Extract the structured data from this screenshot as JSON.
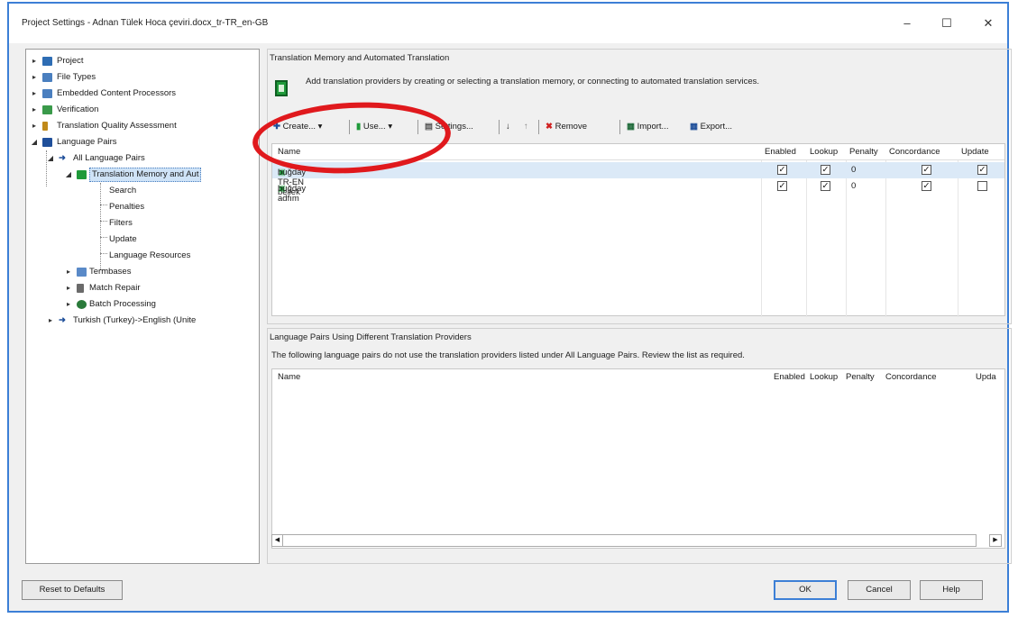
{
  "window": {
    "title": "Project Settings - Adnan Tülek Hoca çeviri.docx_tr-TR_en-GB",
    "controls": [
      "–",
      "☐",
      "✕"
    ]
  },
  "tree": {
    "items": [
      {
        "label": "Project",
        "toggle": "▸",
        "icon": "project-icon",
        "color": "#2e6db4"
      },
      {
        "label": "File Types",
        "toggle": "▸",
        "icon": "file-types-icon",
        "color": "#4a7fbf"
      },
      {
        "label": "Embedded Content Processors",
        "toggle": "▸",
        "icon": "embedded-content-icon",
        "color": "#4a7fbf"
      },
      {
        "label": "Verification",
        "toggle": "▸",
        "icon": "verification-icon",
        "color": "#3a9a4a"
      },
      {
        "label": "Translation Quality Assessment",
        "toggle": "▸",
        "icon": "tqa-icon",
        "color": "#c08a1a"
      },
      {
        "label": "Language Pairs",
        "toggle": "◢",
        "icon": "language-pairs-icon",
        "color": "#1f4f9a"
      },
      {
        "label": "All Language Pairs",
        "toggle": "◢",
        "icon": "arrow-icon",
        "color": "#1f4f9a"
      },
      {
        "label": "Translation Memory and Aut",
        "toggle": "◢",
        "icon": "tm-icon",
        "color": "#1f9a3a"
      },
      {
        "label": "Search"
      },
      {
        "label": "Penalties"
      },
      {
        "label": "Filters"
      },
      {
        "label": "Update"
      },
      {
        "label": "Language Resources"
      },
      {
        "label": "Termbases",
        "toggle": "▸",
        "icon": "termbase-icon",
        "color": "#5a8ac8"
      },
      {
        "label": "Match Repair",
        "toggle": "▸",
        "icon": "match-repair-icon",
        "color": "#6a6a6a"
      },
      {
        "label": "Batch Processing",
        "toggle": "▸",
        "icon": "batch-icon",
        "color": "#2a7a3a"
      },
      {
        "label": "Turkish (Turkey)->English (Unite",
        "toggle": "▸",
        "icon": "arrow-icon",
        "color": "#1f4f9a"
      }
    ]
  },
  "tm": {
    "group_title": "Translation Memory and Automated Translation",
    "description": "Add translation providers by creating or selecting a translation memory, or connecting to automated translation services.",
    "toolbar": {
      "create": "Create...",
      "use": "Use...",
      "settings": "Settings...",
      "remove": "Remove",
      "import": "Import...",
      "export": "Export..."
    },
    "columns": {
      "name": "Name",
      "enabled": "Enabled",
      "lookup": "Lookup",
      "penalty": "Penalty",
      "concordance": "Concordance",
      "update": "Update"
    },
    "rows": [
      {
        "name": "buğday TR-EN bellek",
        "enabled": true,
        "lookup": true,
        "penalty": "0",
        "concordance": true,
        "update": true
      },
      {
        "name": "buğday adfım",
        "enabled": true,
        "lookup": true,
        "penalty": "0",
        "concordance": true,
        "update": false
      }
    ]
  },
  "lp": {
    "group_title": "Language Pairs Using Different Translation Providers",
    "note": "The following language pairs do not use the translation providers listed under All Language Pairs. Review the list as required.",
    "columns": {
      "name": "Name",
      "enabled": "Enabled",
      "lookup": "Lookup",
      "penalty": "Penalty",
      "concordance": "Concordance",
      "update": "Upda"
    }
  },
  "footer": {
    "reset": "Reset to Defaults",
    "ok": "OK",
    "cancel": "Cancel",
    "help": "Help"
  },
  "colors": {
    "highlight": "#e0191d",
    "accent": "#3c7fd6"
  }
}
